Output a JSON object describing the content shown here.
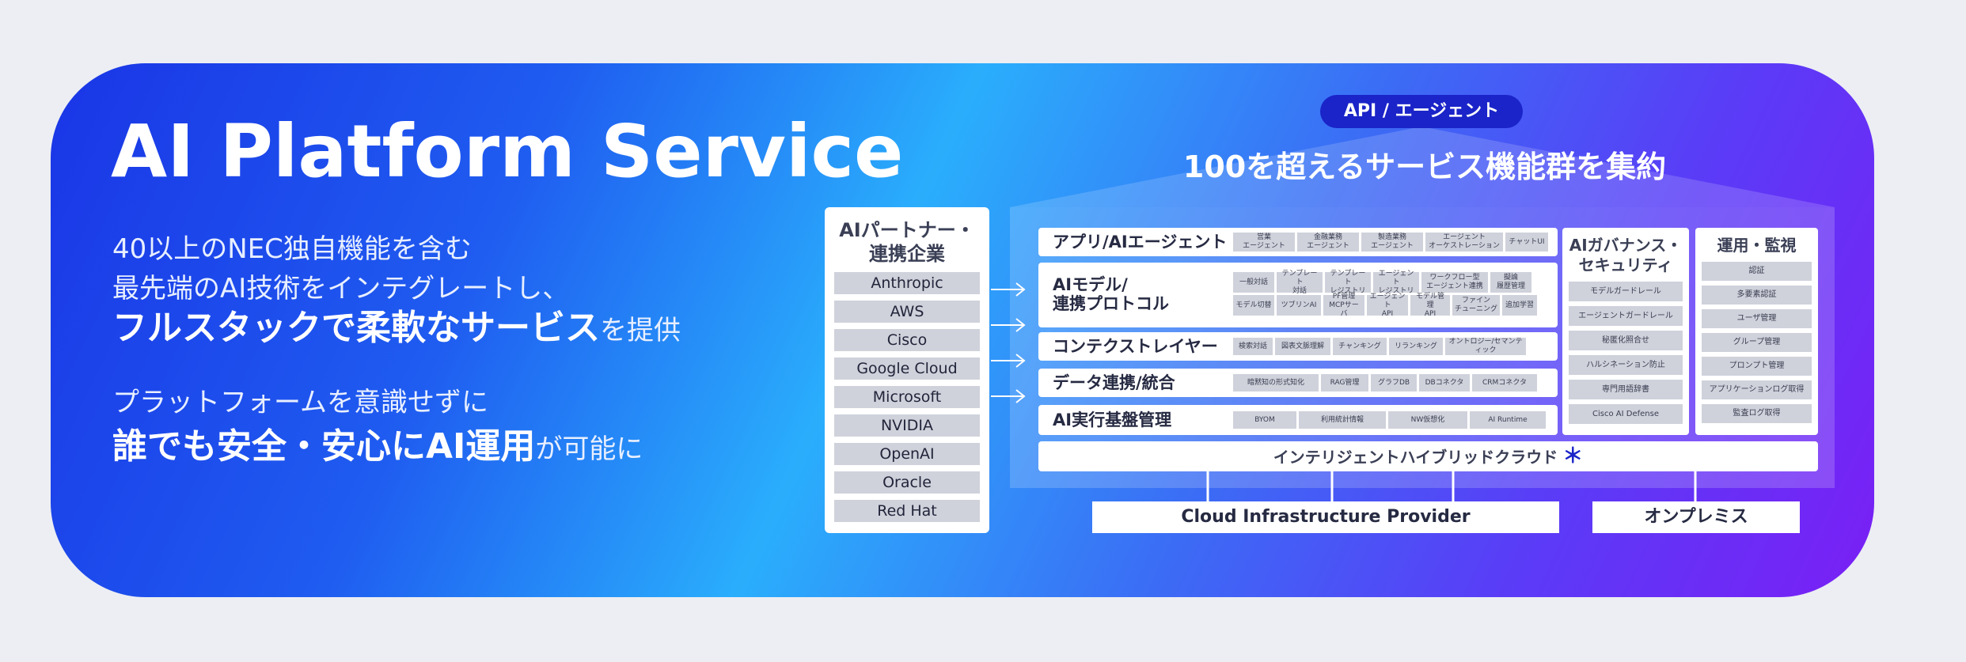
{
  "title": "AI Platform Service",
  "desc1": {
    "line1": "40以上のNEC独自機能を含む",
    "line2": "最先端のAI技術をインテグレートし、",
    "line3_bold": "フルスタックで柔軟なサービス",
    "line3_tail": "を提供"
  },
  "desc2": {
    "line1": "プラットフォームを意識せずに",
    "line2_bold": "誰でも安全・安心にAI運用",
    "line2_tail": "が可能に"
  },
  "api_label": "API / エージェント",
  "services_title": "100を超えるサービス機能群を集約",
  "partners": {
    "title": "AIパートナー・\n連携企業",
    "items": [
      "Anthropic",
      "AWS",
      "Cisco",
      "Google Cloud",
      "Microsoft",
      "NVIDIA",
      "OpenAI",
      "Oracle",
      "Red Hat"
    ]
  },
  "layers": [
    {
      "label": "アプリ/AIエージェント",
      "chips": [
        "営業\nエージェント",
        "金融業務\nエージェント",
        "製造業務\nエージェント",
        "エージェント\nオーケストレーション",
        "チャットUI"
      ]
    },
    {
      "label": "AIモデル/\n連携プロトコル",
      "chips": [
        "一般対話",
        "テンプレート\n対話",
        "テンプレート\nレジストリ",
        "エージェント\nレジストリ",
        "ワークフロー型\nエージェント連携",
        "擬論\n履歴管理",
        "モデル切替",
        "ツブリンAI",
        "PF管理\nMCPサーバ",
        "エージェント\nAPI",
        "モデル管理\nAPI",
        "ファイン\nチューニング",
        "追加学習"
      ]
    },
    {
      "label": "コンテクストレイヤー",
      "chips": [
        "検索対話",
        "図表文脈理解",
        "チャンキング",
        "リランキング",
        "オントロジー/セマンティック"
      ]
    },
    {
      "label": "データ連携/統合",
      "chips": [
        "暗黙知の形式知化",
        "RAG管理",
        "グラフDB",
        "DBコネクタ",
        "CRMコネクタ"
      ]
    },
    {
      "label": "AI実行基盤管理",
      "chips": [
        "BYOM",
        "利用統計情報",
        "NW仮想化",
        "AI Runtime"
      ]
    }
  ],
  "governance": {
    "title": "AIガバナンス・\nセキュリティ",
    "items": [
      "モデルガードレール",
      "エージェントガードレール",
      "秘匿化照合せ",
      "ハルシネーション防止",
      "専門用語辞書",
      "Cisco AI Defense"
    ]
  },
  "operations": {
    "title": "運用・監視",
    "items": [
      "認証",
      "多要素認証",
      "ユーザ管理",
      "グループ管理",
      "プロンプト管理",
      "アプリケーションログ取得",
      "監査ログ取得"
    ]
  },
  "hybrid_cloud": "インテリジェントハイブリッドクラウド",
  "hybrid_mark": "＊",
  "cloud_provider": "Cloud Infrastructure Provider",
  "onprem": "オンプレミス"
}
